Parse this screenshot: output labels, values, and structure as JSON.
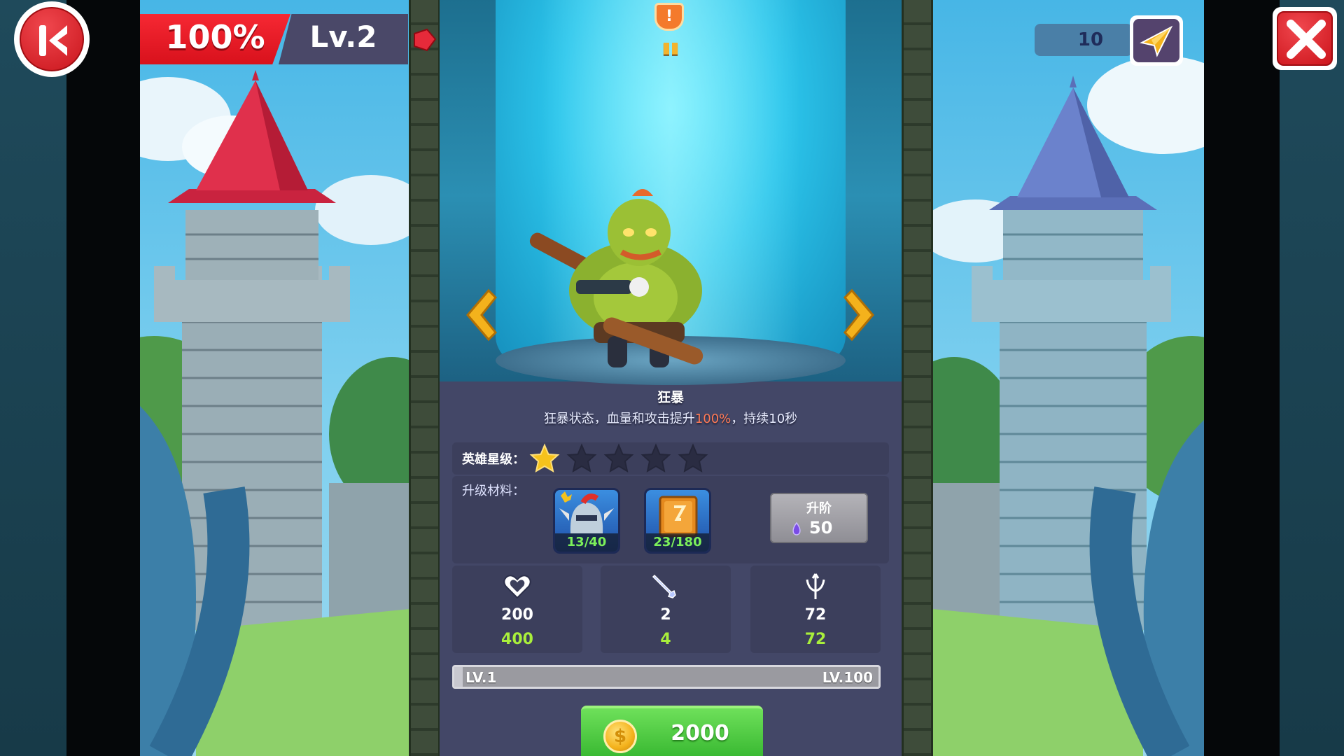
{
  "hud": {
    "health_percent": "100%",
    "level": "Lv.2",
    "energy": "10"
  },
  "hero": {
    "name": "狂暴",
    "description_pre": "狂暴状态，血量和攻击提升",
    "description_highlight": "100%",
    "description_post": "，持续10秒",
    "rank_label": "英雄星级：",
    "stars_filled": 1,
    "stars_total": 5,
    "material_label": "升级材料：",
    "materials": [
      {
        "name": "helmet",
        "count": "13/40"
      },
      {
        "name": "spell-book",
        "count": "23/180"
      }
    ],
    "upgrade_label": "升阶",
    "upgrade_cost": "50",
    "stats": [
      {
        "icon": "heart-icon",
        "base": "200",
        "next": "400"
      },
      {
        "icon": "sword-icon",
        "base": "2",
        "next": "4"
      },
      {
        "icon": "trident-icon",
        "base": "72",
        "next": "72"
      }
    ],
    "level_min": "LV.1",
    "level_max": "LV.100",
    "buy_price": "2000"
  },
  "colors": {
    "accent_red": "#e41c25",
    "accent_green": "#45c23a",
    "stat_next": "#a9ef3b",
    "highlight": "#ff7a55"
  }
}
